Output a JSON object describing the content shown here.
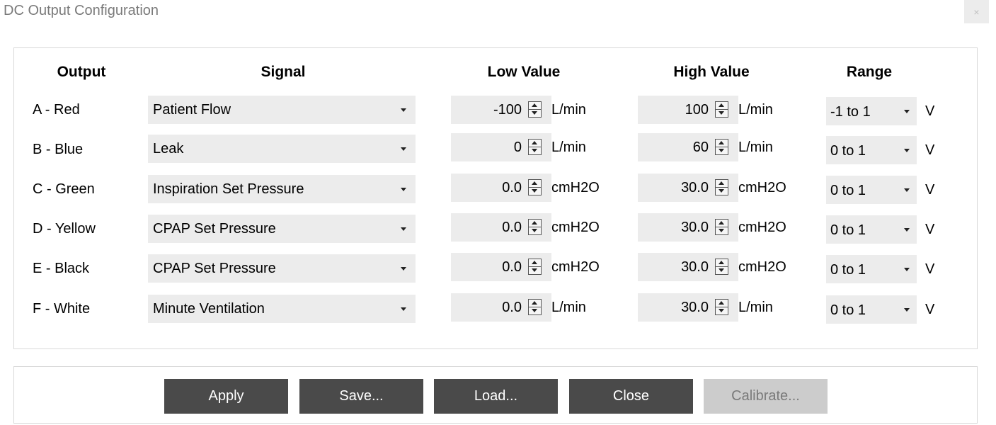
{
  "window": {
    "title": "DC Output Configuration",
    "close_glyph": "×"
  },
  "headers": {
    "output": "Output",
    "signal": "Signal",
    "low": "Low Value",
    "high": "High Value",
    "range": "Range"
  },
  "rows": [
    {
      "output": "A - Red",
      "signal": "Patient Flow",
      "low": "-100",
      "low_unit": "L/min",
      "high": "100",
      "high_unit": "L/min",
      "range": "-1 to 1",
      "range_unit": "V"
    },
    {
      "output": "B - Blue",
      "signal": "Leak",
      "low": "0",
      "low_unit": "L/min",
      "high": "60",
      "high_unit": "L/min",
      "range": "0 to 1",
      "range_unit": "V"
    },
    {
      "output": "C - Green",
      "signal": "Inspiration Set Pressure",
      "low": "0.0",
      "low_unit": "cmH2O",
      "high": "30.0",
      "high_unit": "cmH2O",
      "range": "0 to 1",
      "range_unit": "V"
    },
    {
      "output": "D - Yellow",
      "signal": "CPAP Set Pressure",
      "low": "0.0",
      "low_unit": "cmH2O",
      "high": "30.0",
      "high_unit": "cmH2O",
      "range": "0 to 1",
      "range_unit": "V"
    },
    {
      "output": "E - Black",
      "signal": "CPAP Set Pressure",
      "low": "0.0",
      "low_unit": "cmH2O",
      "high": "30.0",
      "high_unit": "cmH2O",
      "range": "0 to 1",
      "range_unit": "V"
    },
    {
      "output": "F - White",
      "signal": "Minute Ventilation",
      "low": "0.0",
      "low_unit": "L/min",
      "high": "30.0",
      "high_unit": "L/min",
      "range": "0 to 1",
      "range_unit": "V"
    }
  ],
  "buttons": {
    "apply": "Apply",
    "save": "Save...",
    "load": "Load...",
    "close": "Close",
    "calibrate": "Calibrate..."
  },
  "icons": {
    "dropdown": "chevron-down-icon",
    "spinner": "spinner-up-down-icon"
  },
  "colors": {
    "button_bg": "#4a4a4a",
    "button_disabled_bg": "#cccccc",
    "field_bg": "#ececec",
    "title_text": "#7a7a7a"
  }
}
